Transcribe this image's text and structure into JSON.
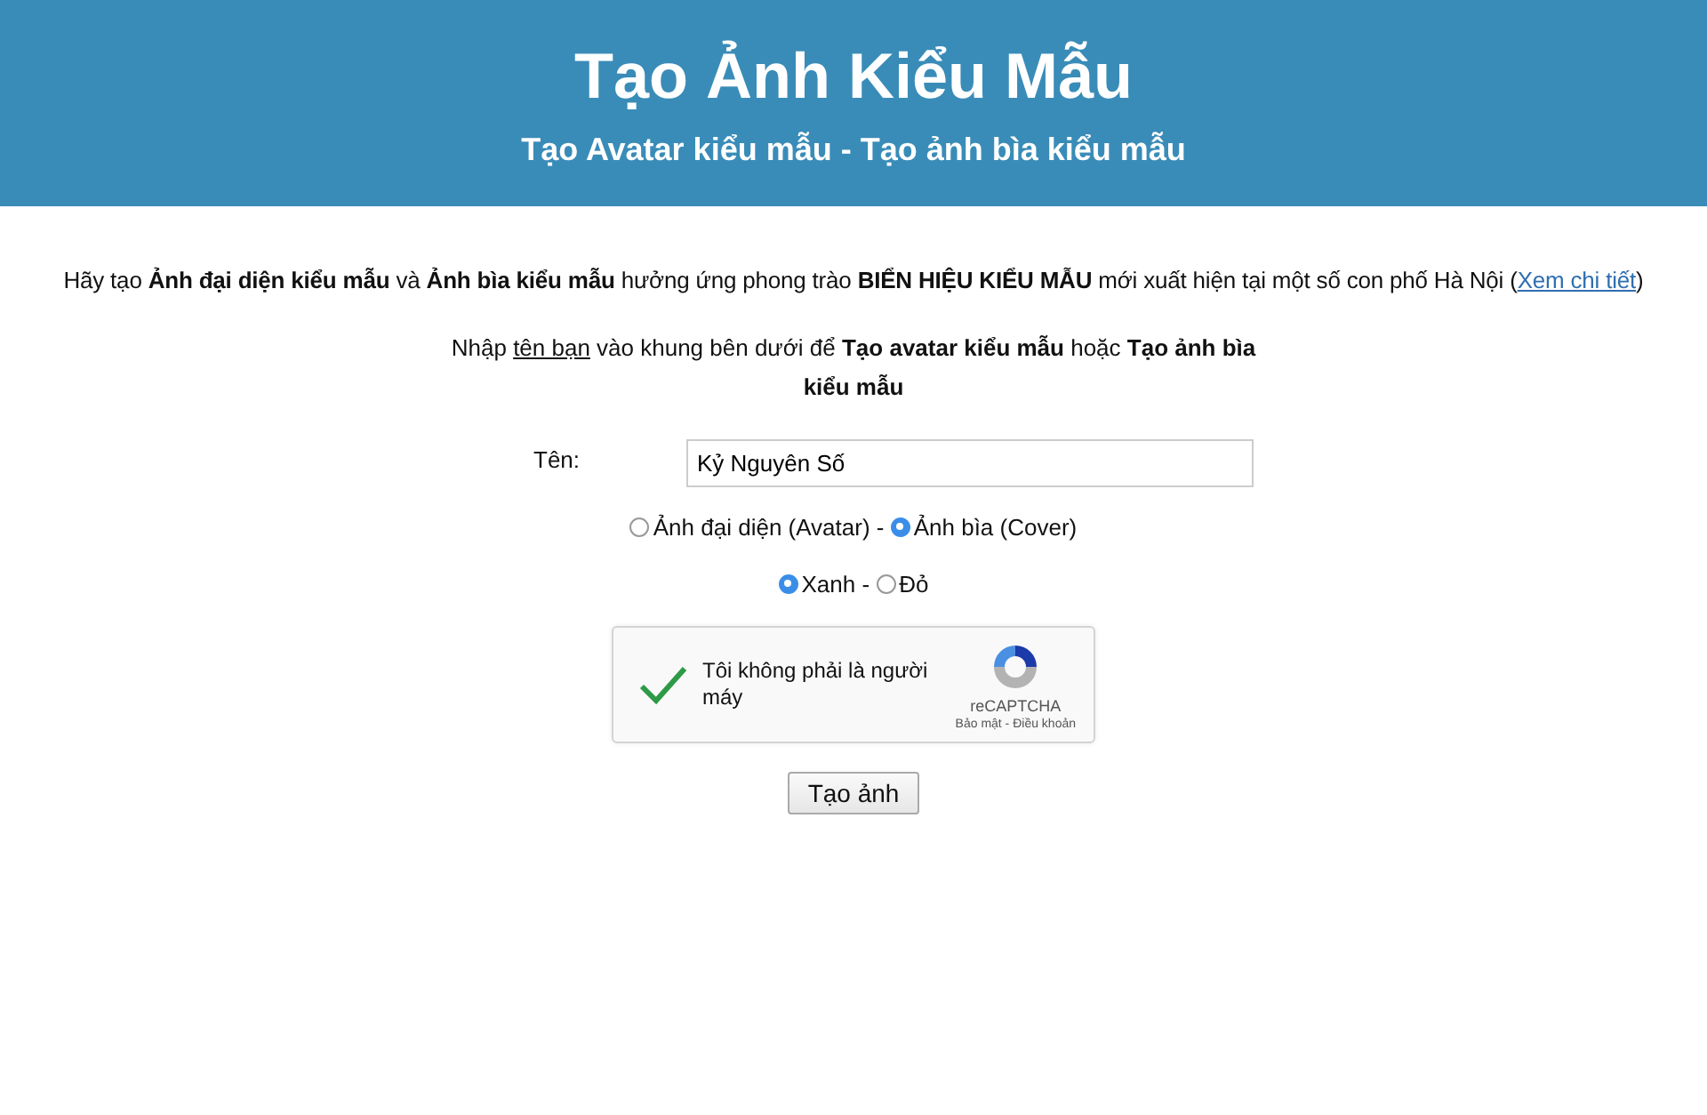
{
  "header": {
    "title": "Tạo Ảnh Kiểu Mẫu",
    "subtitle": "Tạo Avatar kiểu mẫu - Tạo ảnh bìa kiểu mẫu"
  },
  "intro": {
    "text": "Hãy tạo **Ảnh đại diện kiểu mẫu** và **Ảnh bìa kiểu mẫu** hưởng ứng phong trào **BIỂN HIỆU KIỂU MẪU** mới xuất hiện tại một số con phố Hà Nội (",
    "link": "Xem chi tiết",
    "tail": ")"
  },
  "instruction": [
    {
      "kind": "plain",
      "text": "Nhập "
    },
    {
      "kind": "underline",
      "text": "tên bạn"
    },
    {
      "kind": "plain",
      "text": " vào khung bên dưới để **Tạo avatar kiểu mẫu** hoặc **Tạo ảnh bìa kiểu mẫu**"
    }
  ],
  "name_field": {
    "label": "Tên:",
    "value": "Kỷ Nguyên Số"
  },
  "radio_groups": [
    {
      "separator": " - ",
      "options": [
        {
          "label": "Ảnh đại diện (Avatar)",
          "selected": false
        },
        {
          "label": "Ảnh bìa (Cover)",
          "selected": true
        }
      ]
    },
    {
      "separator": " - ",
      "options": [
        {
          "label": "Xanh",
          "selected": true
        },
        {
          "label": "Đỏ",
          "selected": false
        }
      ]
    }
  ],
  "captcha": {
    "label": "Tôi không phải là người máy",
    "checked": true,
    "brand": "reCAPTCHA",
    "links": "Bảo mật - Điều khoản"
  },
  "submit": "Tạo ảnh"
}
